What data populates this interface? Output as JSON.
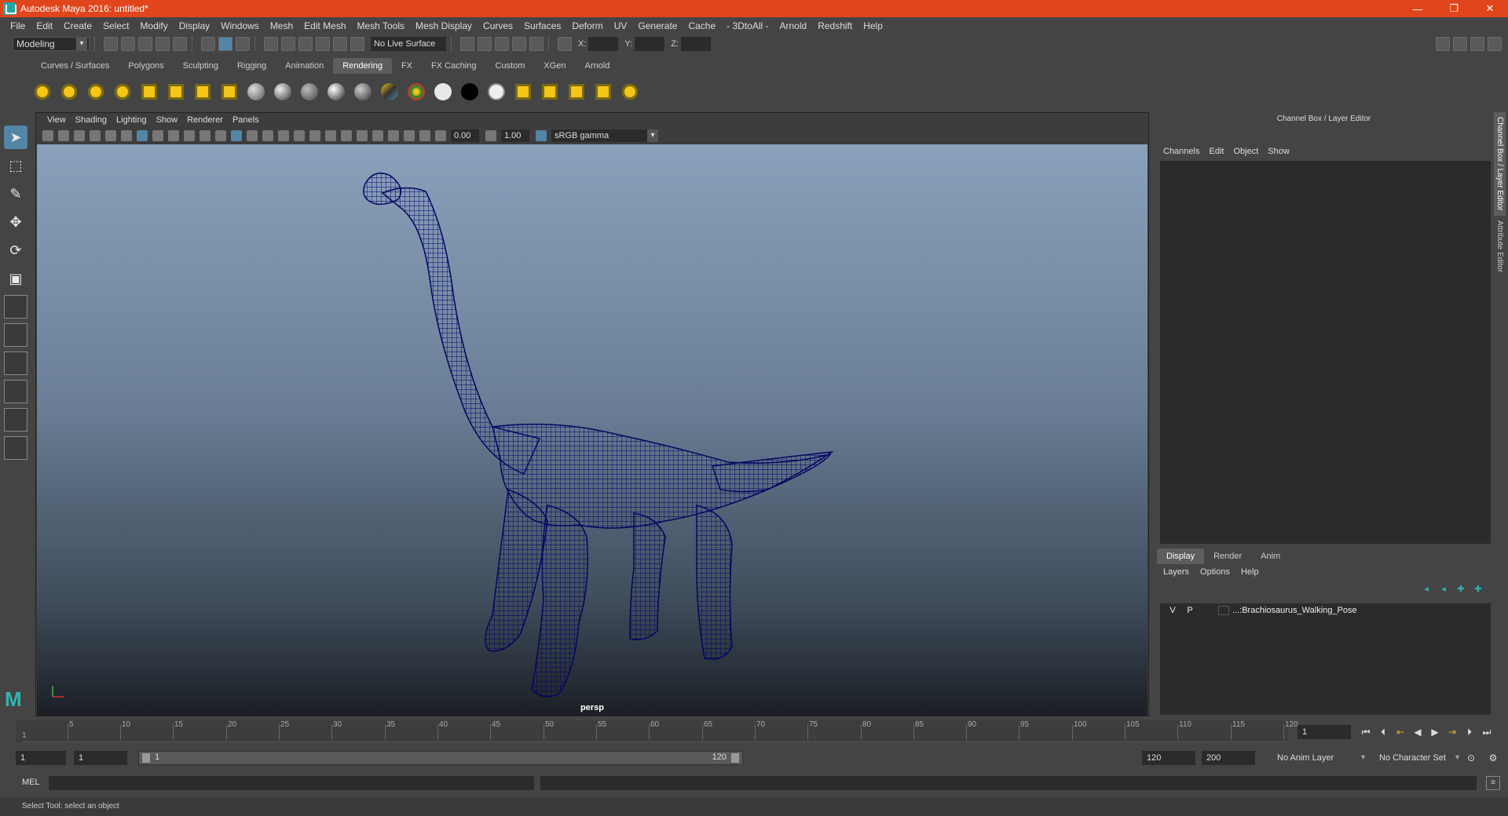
{
  "window": {
    "title": "Autodesk Maya 2016: untitled*"
  },
  "menubar": [
    "File",
    "Edit",
    "Create",
    "Select",
    "Modify",
    "Display",
    "Windows",
    "Mesh",
    "Edit Mesh",
    "Mesh Tools",
    "Mesh Display",
    "Curves",
    "Surfaces",
    "Deform",
    "UV",
    "Generate",
    "Cache",
    "- 3DtoAll -",
    "Arnold",
    "Redshift",
    "Help"
  ],
  "statusline": {
    "mode": "Modeling",
    "live_surface": "No Live Surface",
    "x_label": "X:",
    "y_label": "Y:",
    "z_label": "Z:"
  },
  "shelf_tabs": [
    "Curves / Surfaces",
    "Polygons",
    "Sculpting",
    "Rigging",
    "Animation",
    "Rendering",
    "FX",
    "FX Caching",
    "Custom",
    "XGen",
    "Arnold"
  ],
  "shelf_active": "Rendering",
  "viewport": {
    "menus": [
      "View",
      "Shading",
      "Lighting",
      "Show",
      "Renderer",
      "Panels"
    ],
    "exposure": "0.00",
    "gamma": "1.00",
    "colorspace": "sRGB gamma",
    "camera": "persp",
    "model_color": "#0b0b74"
  },
  "channel_box": {
    "title": "Channel Box / Layer Editor",
    "menus": [
      "Channels",
      "Edit",
      "Object",
      "Show"
    ]
  },
  "layer_editor": {
    "tabs": [
      "Display",
      "Render",
      "Anim"
    ],
    "active_tab": "Display",
    "menus": [
      "Layers",
      "Options",
      "Help"
    ],
    "layers": [
      {
        "v": "V",
        "p": "P",
        "name": "...:Brachiosaurus_Walking_Pose"
      }
    ]
  },
  "side_tabs": [
    "Channel Box / Layer Editor",
    "Attribute Editor"
  ],
  "timeline": {
    "labels": [
      "5",
      "10",
      "15",
      "20",
      "25",
      "30",
      "35",
      "40",
      "45",
      "50",
      "55",
      "60",
      "65",
      "70",
      "75",
      "80",
      "85",
      "90",
      "95",
      "100",
      "105",
      "110",
      "115",
      "120"
    ],
    "start_label": "1",
    "current_frame": "1"
  },
  "range": {
    "start": "1",
    "playback_start": "1",
    "slider_lo": "1",
    "slider_hi": "120",
    "playback_end": "120",
    "end": "200",
    "anim_layer": "No Anim Layer",
    "character_set": "No Character Set"
  },
  "command": {
    "language": "MEL"
  },
  "help": {
    "text": "Select Tool: select an object"
  }
}
